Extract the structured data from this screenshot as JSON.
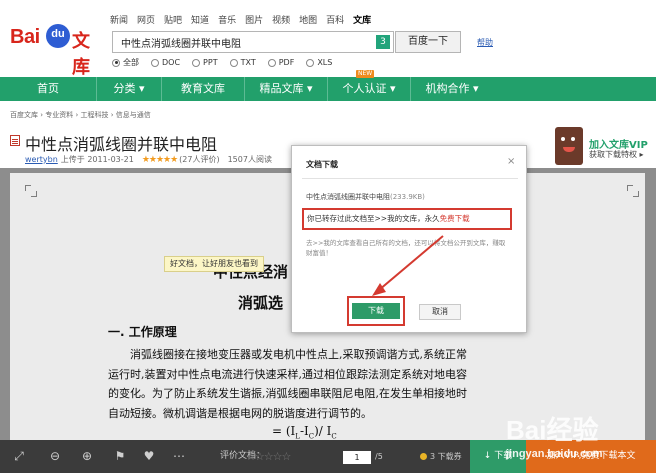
{
  "header": {
    "logo_bai": "Bai",
    "logo_du": "du",
    "logo_wenku": "文库",
    "nav_links": [
      "新闻",
      "网页",
      "贴吧",
      "知道",
      "音乐",
      "图片",
      "视频",
      "地图",
      "百科",
      "文库"
    ],
    "active_nav": "文库",
    "search_value": "中性点消弧线圈并联中电阻",
    "search_badge": "3",
    "search_button": "百度一下",
    "help_link": "帮助",
    "filters": [
      {
        "label": "全部",
        "checked": true
      },
      {
        "label": "DOC",
        "checked": false
      },
      {
        "label": "PPT",
        "checked": false
      },
      {
        "label": "TXT",
        "checked": false
      },
      {
        "label": "PDF",
        "checked": false
      },
      {
        "label": "XLS",
        "checked": false
      }
    ]
  },
  "navbar": {
    "items": [
      "首页",
      "分类 ▾",
      "教育文库",
      "精品文库 ▾",
      "个人认证 ▾",
      "机构合作 ▾"
    ],
    "new_tag": "NEW",
    "bg_color": "#22a06b"
  },
  "breadcrumb": "百度文库 › 专业资料 › 工程科技 › 信息与通信",
  "document": {
    "title": "中性点消弧线圈并联中电阻",
    "uploader": "wertybn",
    "upload_info": "上传于 2011-03-21",
    "stars": "★★★★★",
    "rating_count": "(27人评价)",
    "views": "1507人阅读",
    "heading1": "中性点经消",
    "heading2": "消弧选",
    "section": "一. 工作原理",
    "paragraph_lines": [
      "　　消弧线圈接在接地变压器或发电机中性点上,采取预调谐方式,系统正常",
      "运行时,装置对中性点电流进行快速采样,通过相位跟踪法测定系统对地电容",
      "的变化。为了防止系统发生谐振,消弧线圈串联阻尼电阻,在发生单相接地时",
      "自动短接。微机调谐是根据电网的脱谐度进行调节的。"
    ],
    "formula_prefix": "= (I",
    "formula_sub1": "L",
    "formula_mid": "-I",
    "formula_sub2": "C",
    "formula_suffix": ")/ I",
    "formula_sub3": "C",
    "tip_badge": "好文档，让好朋友也看到"
  },
  "vip_promo": {
    "title": "加入文库VIP",
    "subtitle": "获取下载特权 ▸"
  },
  "dialog": {
    "title": "文档下载",
    "close": "×",
    "file_name": "中性点消弧线圈并联中电阻",
    "file_size": "(233.9KB)",
    "message_prefix": "你已转存过此文档至>>我的文库，永久",
    "message_highlight": "免费下载",
    "note": "去>>我的文库查看自己所有的文档，还可以将文档公开到文库，赚取财富值！",
    "download_button": "下载",
    "cancel_button": "取消",
    "highlight_color": "#d43a30"
  },
  "toolbar": {
    "rating_label": "评价文档：",
    "rating_stars": "☆☆☆☆☆",
    "page_current": "1",
    "page_total": "/5",
    "coin_label": "3 下载券",
    "download_label": "↓ 下载",
    "vip_label": "加入VIP,免费下载本文"
  },
  "watermark": {
    "logo": "Bai经验",
    "url": "jingyan.baidu.com"
  }
}
